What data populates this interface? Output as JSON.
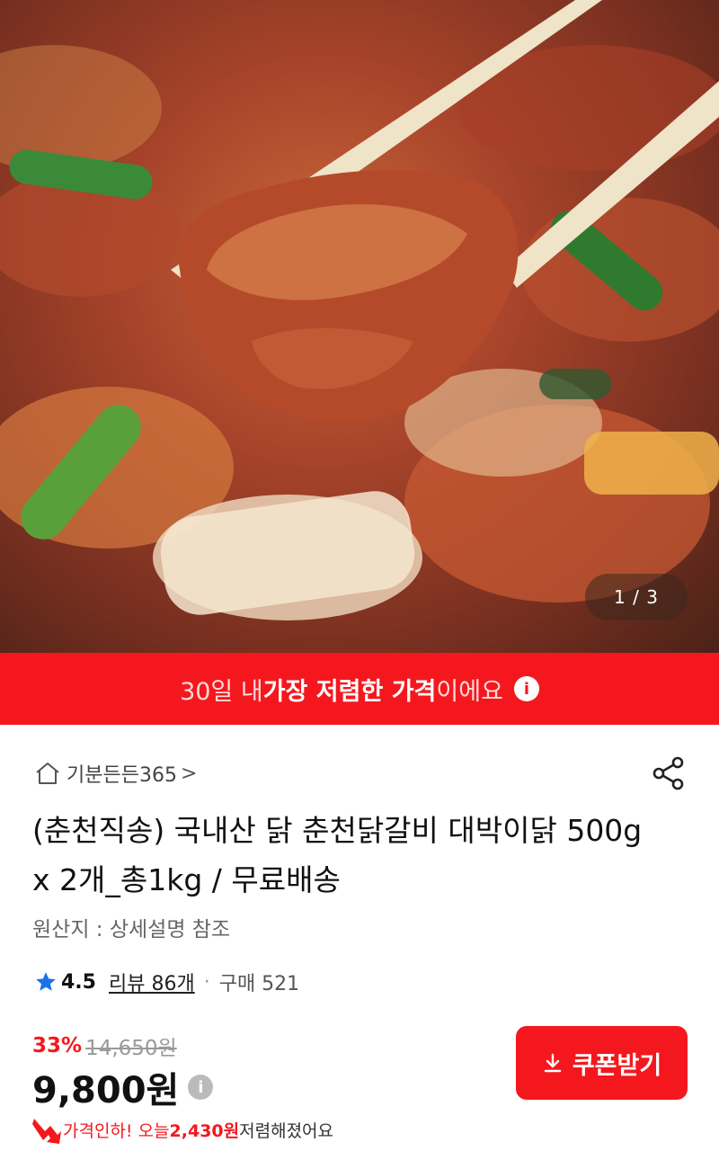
{
  "hero": {
    "page_counter": "1 / 3"
  },
  "banner": {
    "prefix": "30일 내 ",
    "highlight": "가장 저렴한 가격",
    "suffix": "이에요",
    "info_icon": "info-icon"
  },
  "store": {
    "name": "기분든든365",
    "chevron": ">"
  },
  "product": {
    "title": "(춘천직송) 국내산 닭 춘천닭갈비 대박이닭 500g x 2개_총1kg / 무료배송",
    "origin": "원산지 : 상세설명 참조"
  },
  "rating": {
    "score": "4.5",
    "review_link": "리뷰 86개",
    "separator": "·",
    "purchase": "구매 521"
  },
  "pricing": {
    "discount_pct": "33%",
    "original_price": "14,650원",
    "price": "9,800원",
    "coupon_button": "쿠폰받기",
    "drop_label": "가격인하! 오늘 ",
    "drop_amount": "2,430원",
    "drop_suffix": " 저렴해졌어요"
  },
  "colors": {
    "accent": "#f4181e",
    "star": "#1a73e8"
  }
}
